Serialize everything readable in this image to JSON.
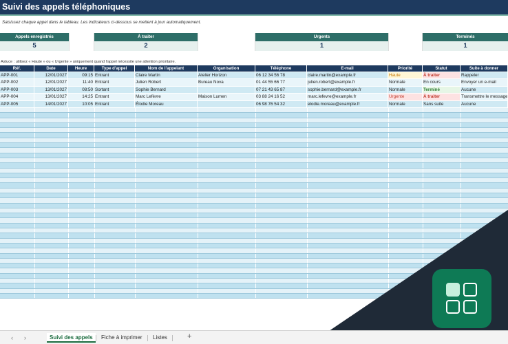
{
  "sheet": {
    "title": "Suivi des appels téléphoniques",
    "subtitle": "Saisissez chaque appel dans le tableau. Les indicateurs ci-dessous se mettent à jour automatiquement.",
    "tip": "Astuce : utilisez « Haute » ou « Urgente » uniquement quand l'appel nécessite une attention prioritaire."
  },
  "kpis": [
    {
      "label": "Appels enregistrés",
      "value": "5"
    },
    {
      "label": "À traiter",
      "value": "2"
    },
    {
      "label": "Urgents",
      "value": "1"
    },
    {
      "label": "Terminés",
      "value": "1"
    }
  ],
  "table": {
    "headers": [
      "Réf.",
      "Date",
      "Heure",
      "Type d'appel",
      "Nom de l'appelant",
      "Organisation",
      "Téléphone",
      "E-mail",
      "Priorité",
      "Statut",
      "Suite à donner"
    ],
    "rows": [
      [
        "APP-001",
        "12/01/2027",
        "09:15",
        "Entrant",
        "Claire Martin",
        "Atelier Horizon",
        "06 12 34 56 78",
        "claire.martin@example.fr",
        "Haute",
        "À traiter",
        "Rappeler"
      ],
      [
        "APP-002",
        "12/01/2027",
        "11:40",
        "Entrant",
        "Julien Robert",
        "Bureau Nova",
        "01 44 55 66 77",
        "julien.robert@example.fr",
        "Normale",
        "En cours",
        "Envoyer un e-mail"
      ],
      [
        "APP-003",
        "13/01/2027",
        "08:50",
        "Sortant",
        "Sophie Bernard",
        "",
        "07 21 43 65 87",
        "sophie.bernard@example.fr",
        "Normale",
        "Terminé",
        "Aucune"
      ],
      [
        "APP-004",
        "13/01/2027",
        "14:25",
        "Entrant",
        "Marc Lefèvre",
        "Maison Lumen",
        "03 88 24 16 52",
        "marc.lefevre@example.fr",
        "Urgente",
        "À traiter",
        "Transmettre le message"
      ],
      [
        "APP-005",
        "14/01/2027",
        "10:05",
        "Entrant",
        "Élodie Moreau",
        "",
        "06 98 76 54 32",
        "elodie.moreau@example.fr",
        "Normale",
        "Sans suite",
        "Aucune"
      ]
    ]
  },
  "tabs": [
    "Suivi des appels",
    "Fiche à imprimer",
    "Listes"
  ],
  "nav": {
    "prev": "‹",
    "next": "›",
    "add": "+"
  },
  "colors": {
    "header": "#1e3a5f",
    "accent": "#2e6e68",
    "urgent": "#c0392b",
    "done": "#2e7d32",
    "logo": "#0e7a55",
    "corner": "#1f2a37"
  }
}
